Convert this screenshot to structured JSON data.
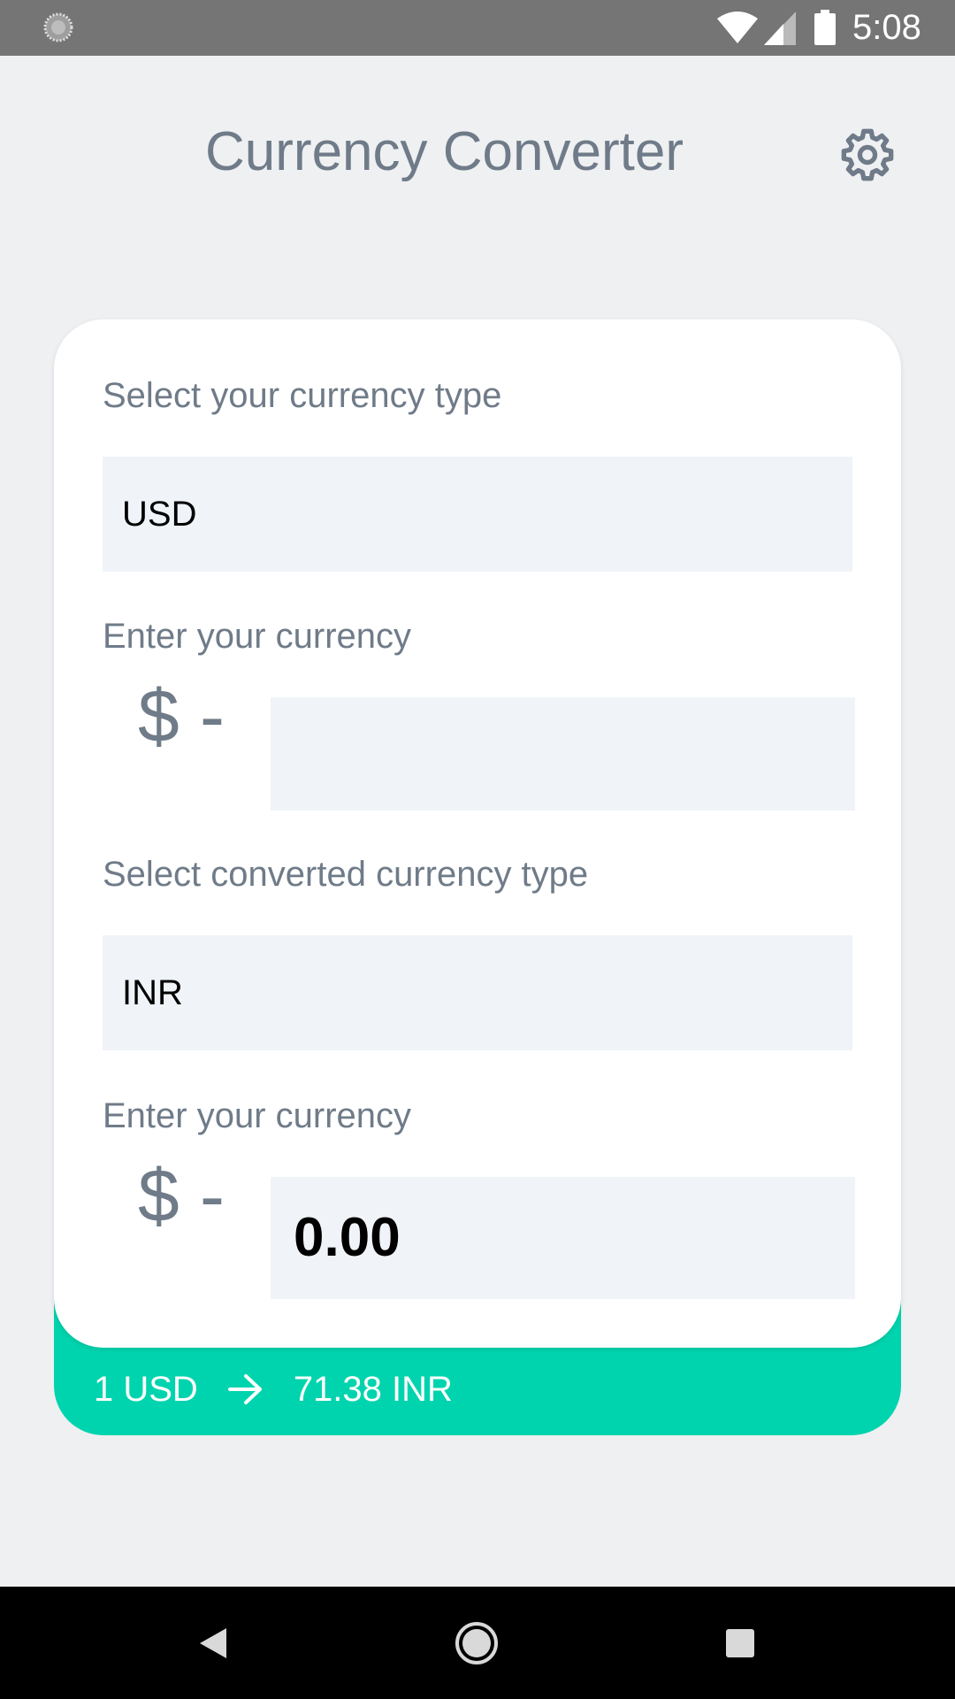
{
  "status_bar": {
    "time": "5:08",
    "icons": [
      "loading-icon",
      "wifi-icon",
      "cell-signal-icon",
      "battery-icon"
    ]
  },
  "header": {
    "title": "Currency Converter",
    "settings_icon": "gear-icon"
  },
  "converter": {
    "source": {
      "type_label": "Select your currency type",
      "selected_currency": "USD",
      "amount_label": "Enter your currency",
      "symbol": "$ -",
      "amount_value": "",
      "amount_placeholder": ""
    },
    "target": {
      "type_label": "Select converted currency type",
      "selected_currency": "INR",
      "amount_label": "Enter your currency",
      "symbol": "$ -",
      "amount_value": "0.00"
    }
  },
  "rate": {
    "from": "1 USD",
    "arrow_icon": "arrow-right-icon",
    "to": "71.38 INR"
  },
  "nav_bar": {
    "icons": [
      "back-icon",
      "home-icon",
      "recents-icon"
    ]
  },
  "colors": {
    "accent": "#00d4ae",
    "text_muted": "#6f7b88",
    "field_background": "#f0f4f8",
    "page_background": "#eff0f2",
    "status_bar": "#757575"
  }
}
